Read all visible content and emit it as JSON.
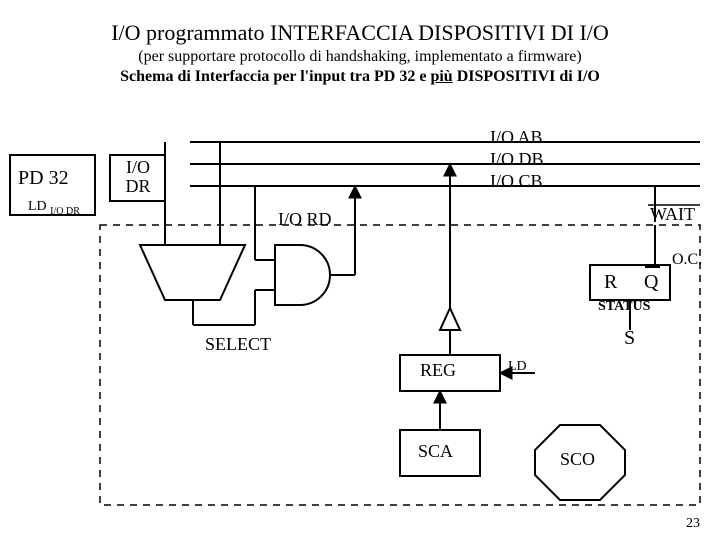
{
  "title": "I/O programmato INTERFACCIA DISPOSITIVI DI I/O",
  "subtitle1": "(per supportare protocollo di handshaking, implementato a firmware)",
  "subtitle2_a": "Schema di Interfaccia per l'input tra PD 32 e ",
  "subtitle2_u": "più",
  "subtitle2_b": " DISPOSITIVI di I/O",
  "blocks": {
    "pd32": "PD 32",
    "iodr": "I/O\nDR",
    "ld_iodr_a": "LD",
    "ld_iodr_b": "I/O DR",
    "iord": "I/O RD",
    "select": "SELECT",
    "reg": "REG",
    "reg_ld": "LD",
    "sca": "SCA",
    "sco": "SCO",
    "ioab": "I/O AB",
    "iodb": "I/O DB",
    "iocb": "I/O CB",
    "wait": "WAIT",
    "rq_r": "R",
    "rq_q": "Q",
    "status": "STATUS",
    "s": "S",
    "oc": "O.C."
  },
  "pagenum": "23"
}
